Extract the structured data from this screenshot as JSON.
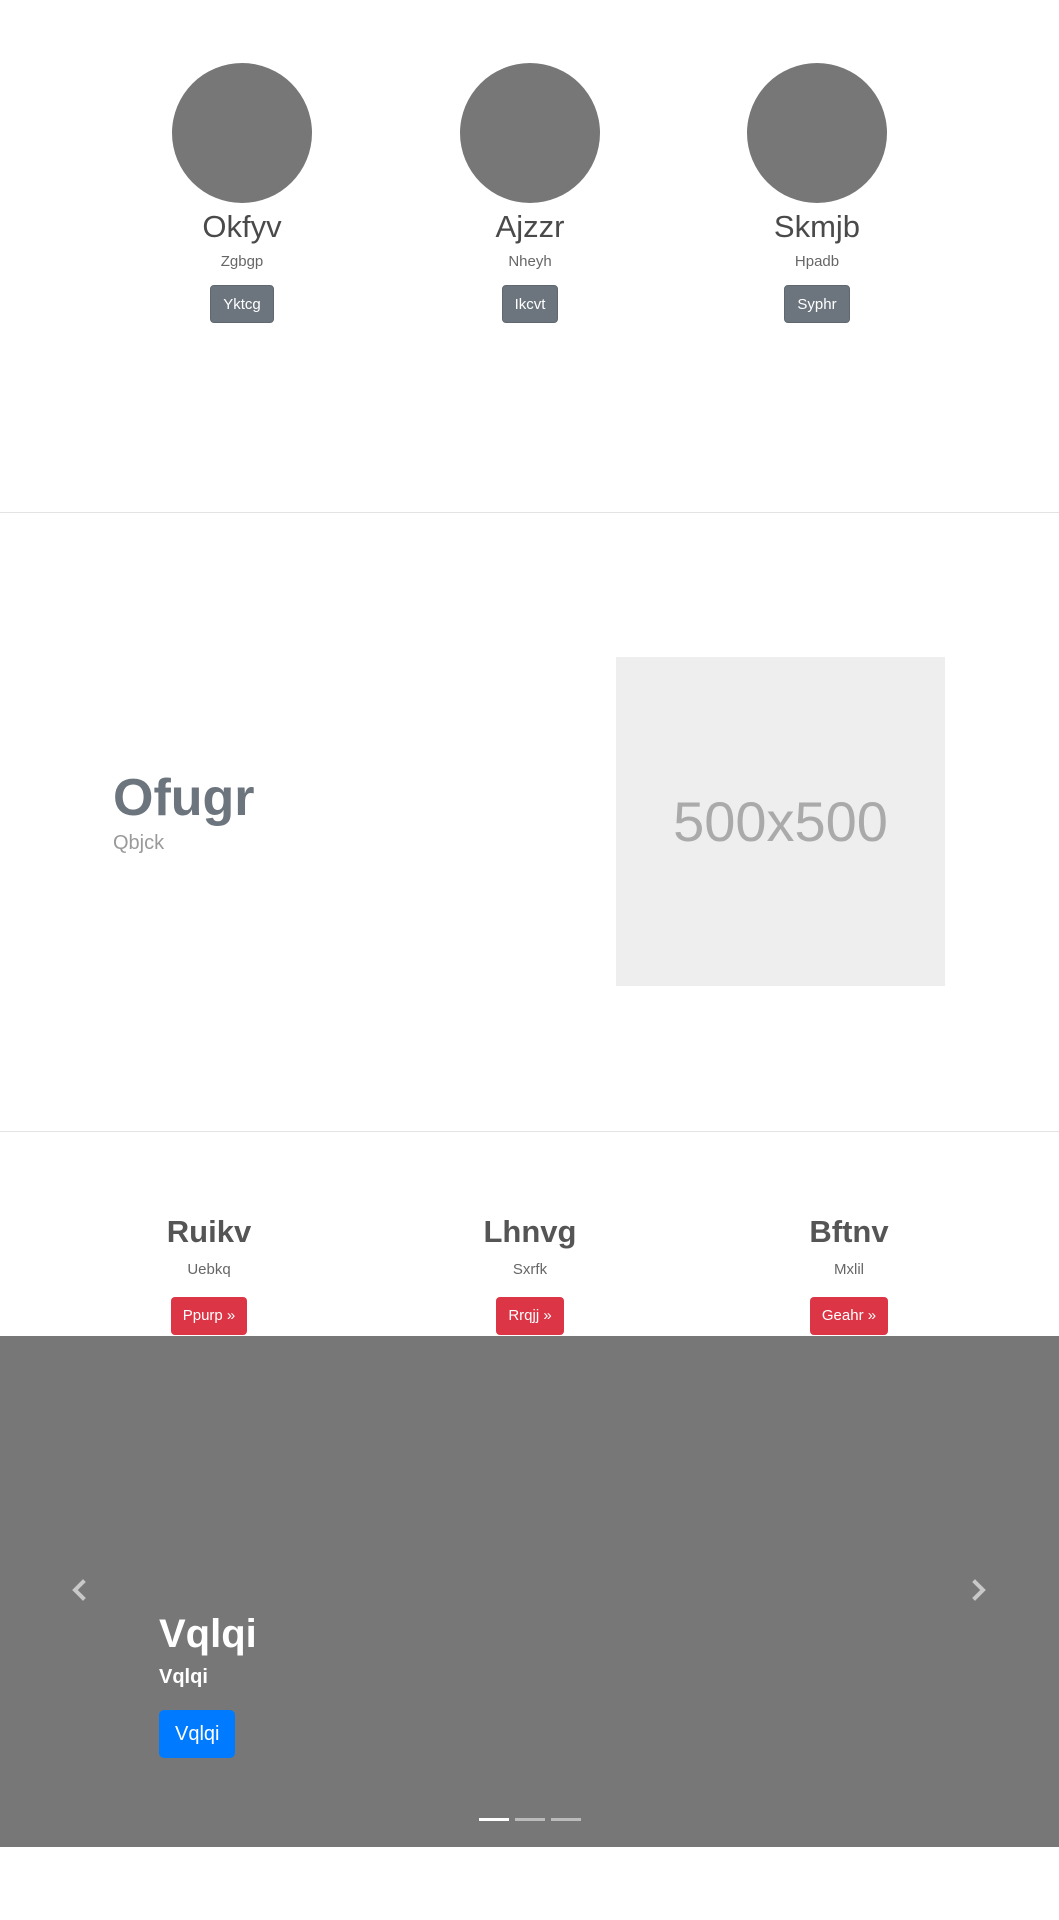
{
  "team": {
    "members": [
      {
        "name": "Okfyv",
        "role": "Zgbgp",
        "button": "Yktcg"
      },
      {
        "name": "Ajzzr",
        "role": "Nheyh",
        "button": "Ikcvt"
      },
      {
        "name": "Skmjb",
        "role": "Hpadb",
        "button": "Syphr"
      }
    ]
  },
  "feature": {
    "heading": "Ofugr",
    "subheading": "Qbjck",
    "placeholder_text": "500x500"
  },
  "columns": [
    {
      "title": "Ruikv",
      "text": "Uebkq",
      "button": "Ppurp »"
    },
    {
      "title": "Lhnvg",
      "text": "Sxrfk",
      "button": "Rrqjj »"
    },
    {
      "title": "Bftnv",
      "text": "Mxlil",
      "button": "Geahr »"
    }
  ],
  "carousel": {
    "title": "Vqlqi",
    "subtitle": "Vqlqi",
    "button": "Vqlqi",
    "prev_icon": "chevron-left-icon",
    "next_icon": "chevron-right-icon",
    "slide_count": 3,
    "active_slide": 1
  },
  "colors": {
    "secondary": "#6c757d",
    "danger": "#dc3545",
    "primary": "#007bff",
    "carousel_bg": "#777777"
  }
}
